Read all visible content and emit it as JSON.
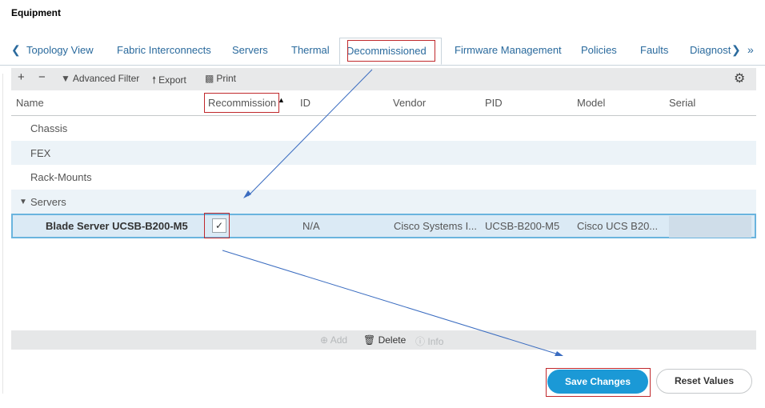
{
  "page": {
    "title": "Equipment"
  },
  "tabs": {
    "items": [
      "Topology View",
      "Fabric Interconnects",
      "Servers",
      "Thermal",
      "Decommissioned",
      "Firmware Management",
      "Policies",
      "Faults",
      "Diagnost"
    ],
    "active_index": 4
  },
  "toolbar": {
    "add": "+",
    "remove": "−",
    "advanced_filter": "Advanced Filter",
    "export": "Export",
    "print": "Print"
  },
  "columns": [
    "Name",
    "Recommission",
    "ID",
    "Vendor",
    "PID",
    "Model",
    "Serial"
  ],
  "rows": [
    "Chassis",
    "FEX",
    "Rack-Mounts",
    "Servers"
  ],
  "selected_row": {
    "name": "Blade Server UCSB-B200-M5",
    "recommission_checked": true,
    "id": "N/A",
    "vendor": "Cisco Systems I...",
    "pid": "UCSB-B200-M5",
    "model": "Cisco UCS B20...",
    "serial": ""
  },
  "footer": {
    "add": "Add",
    "delete": "Delete",
    "info": "Info"
  },
  "buttons": {
    "save": "Save Changes",
    "reset": "Reset Values"
  },
  "colors": {
    "accent": "#1b99d6",
    "highlight": "#c0282c",
    "arrow": "#3a6cc0"
  }
}
